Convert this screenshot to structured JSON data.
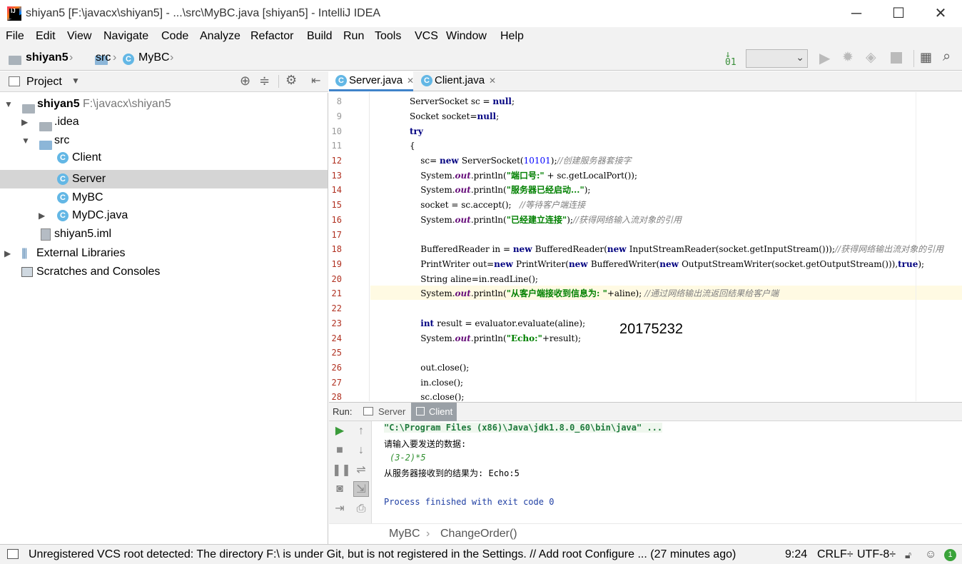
{
  "window": {
    "title": "shiyan5 [F:\\javacx\\shiyan5] - ...\\src\\MyBC.java [shiyan5] - IntelliJ IDEA",
    "logo_text": "IJ",
    "minimize": "─",
    "maximize": "☐",
    "close": "✕"
  },
  "menu": [
    "File",
    "Edit",
    "View",
    "Navigate",
    "Code",
    "Analyze",
    "Refactor",
    "Build",
    "Run",
    "Tools",
    "VCS",
    "Window",
    "Help"
  ],
  "navbar": {
    "crumbs": [
      "shiyan5",
      "src",
      "MyBC"
    ],
    "run_config_select": ""
  },
  "project": {
    "header": "Project",
    "tree": [
      {
        "label": "shiyan5",
        "path": "F:\\javacx\\shiyan5",
        "arrow": "▼",
        "icon": "folder-icon"
      },
      {
        "label": ".idea",
        "arrow": "▶",
        "icon": "folder-icon"
      },
      {
        "label": "src",
        "arrow": "▼",
        "icon": "folder-icon"
      },
      {
        "label": "Client",
        "icon": "class-icon"
      },
      {
        "label": "Server",
        "icon": "class-icon",
        "selected": true
      },
      {
        "label": "MyBC",
        "icon": "class-icon"
      },
      {
        "label": "MyDC.java",
        "arrow": "▶",
        "icon": "class-icon"
      },
      {
        "label": "shiyan5.iml",
        "icon": "file-icon"
      },
      {
        "label": "External Libraries",
        "arrow": "▶",
        "icon": "library-icon"
      },
      {
        "label": "Scratches and Consoles",
        "icon": "scratch-icon"
      }
    ]
  },
  "editor": {
    "tabs": [
      {
        "label": "Server.java",
        "close": "✕",
        "active": true
      },
      {
        "label": "Client.java",
        "close": "✕",
        "active": false
      }
    ],
    "line_numbers": [
      "8",
      "9",
      "10",
      "11",
      "12",
      "13",
      "14",
      "15",
      "16",
      "17",
      "18",
      "19",
      "20",
      "21",
      "22",
      "23",
      "24",
      "25",
      "26",
      "27",
      "28"
    ],
    "watermark": "20175232"
  },
  "run": {
    "label": "Run:",
    "tabs": [
      "Server",
      "Client"
    ],
    "output": [
      "\"C:\\Program Files (x86)\\Java\\jdk1.8.0_60\\bin\\java\" ...",
      "请输入要发送的数据:",
      "(3-2)*5",
      "从服务器接收到的结果为: Echo:5",
      "",
      "Process finished with exit code 0"
    ]
  },
  "breadcrumb_bottom": [
    "MyBC",
    "ChangeOrder()"
  ],
  "status": {
    "message": "Unregistered VCS root detected: The directory F:\\ is under Git, but is not registered in the Settings. // Add root  Configure ... (27 minutes ago)",
    "position": "9:24",
    "line_sep": "CRLF÷",
    "encoding": "UTF-8÷",
    "badge": "1"
  }
}
